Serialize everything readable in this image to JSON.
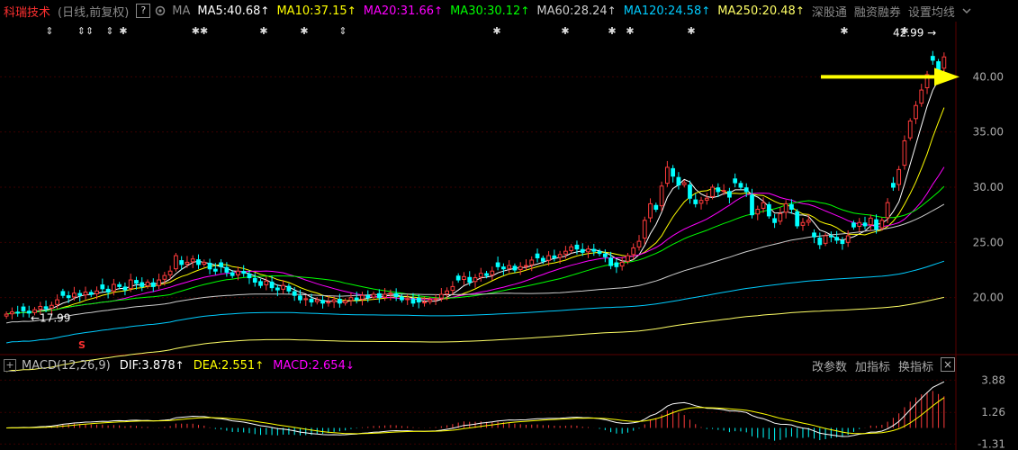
{
  "toolbar": {
    "title": "科瑞技术",
    "period": "(日线,前复权)",
    "help_label": "?",
    "gear_icon": "gear-icon",
    "ma_label": "MA",
    "ma_items": [
      {
        "label": "MA5:40.68",
        "color": "#ffffff",
        "arrow": "↑"
      },
      {
        "label": "MA10:37.15",
        "color": "#ffff00",
        "arrow": "↑"
      },
      {
        "label": "MA20:31.66",
        "color": "#ff00ff",
        "arrow": "↑"
      },
      {
        "label": "MA30:30.12",
        "color": "#00ff00",
        "arrow": "↑"
      },
      {
        "label": "MA60:28.24",
        "color": "#cccccc",
        "arrow": "↑"
      },
      {
        "label": "MA120:24.58",
        "color": "#00ccff",
        "arrow": "↑"
      },
      {
        "label": "MA250:20.48",
        "color": "#ffff66",
        "arrow": "↑"
      }
    ],
    "links": [
      "深股通",
      "融资融券",
      "设置均线"
    ],
    "chevron_icon": "chevron-down-icon"
  },
  "macd_bar": {
    "plus_label": "+",
    "name": "MACD(12,26,9)",
    "dif": "DIF:3.878",
    "dea": "DEA:2.551",
    "macd": "MACD:2.654",
    "dif_arrow": "↑",
    "dea_arrow": "↑",
    "macd_arrow": "↓",
    "buttons": [
      "改参数",
      "加指标",
      "换指标"
    ],
    "close_label": "×"
  },
  "colors": {
    "up": "#ff3b3b",
    "down": "#00ffff",
    "grid": "#3a0000",
    "axis": "#aaaaaa",
    "annotation_arrow": "#ffff00",
    "dif": "#ffffff",
    "dea": "#ffff00",
    "macd": "#ff00ff"
  },
  "chart_data": [
    {
      "type": "candlestick",
      "y_ticks": [
        "40.00",
        "35.00",
        "30.00",
        "25.00",
        "20.00"
      ],
      "ylim": [
        15.0,
        45.0
      ],
      "grid": true,
      "max_label": "42.99",
      "min_label": "17.99",
      "max_marker": "→",
      "min_marker": "←",
      "event_marks": [
        "⇕",
        "⇕⇕",
        "⇕",
        "✱",
        "✱✱",
        "✱",
        "✱",
        "⇕",
        "✱",
        "✱",
        "✱",
        "✱",
        "✱",
        "✱",
        "✱"
      ],
      "bottom_mark": "S",
      "close": [
        18.5,
        18.7,
        18.6,
        18.8,
        18.6,
        18.9,
        19.2,
        19.0,
        19.3,
        19.8,
        20.2,
        20.0,
        20.4,
        20.2,
        20.5,
        20.3,
        20.6,
        20.8,
        20.5,
        21.2,
        21.0,
        20.7,
        21.6,
        21.3,
        21.0,
        21.4,
        21.0,
        21.6,
        22.0,
        22.4,
        23.8,
        23.0,
        23.2,
        23.5,
        23.0,
        23.2,
        22.6,
        22.4,
        22.8,
        22.3,
        22.0,
        22.4,
        22.2,
        21.8,
        21.4,
        21.1,
        21.5,
        20.9,
        20.7,
        21.1,
        20.6,
        20.2,
        19.8,
        19.9,
        19.6,
        19.8,
        19.5,
        19.6,
        19.8,
        19.5,
        19.7,
        20.0,
        19.8,
        20.2,
        20.0,
        20.3,
        20.0,
        20.3,
        20.4,
        20.1,
        19.8,
        19.9,
        19.5,
        19.6,
        19.6,
        19.8,
        19.9,
        20.3,
        20.6,
        21.0,
        21.6,
        21.9,
        21.4,
        21.8,
        22.2,
        22.0,
        22.4,
        22.8,
        22.6,
        22.9,
        22.5,
        22.8,
        22.9,
        23.4,
        23.6,
        23.3,
        23.8,
        23.6,
        23.9,
        24.2,
        24.6,
        24.4,
        24.1,
        24.4,
        24.2,
        24.0,
        23.7,
        22.9,
        22.8,
        23.2,
        23.8,
        24.5,
        25.1,
        27.0,
        28.5,
        28.0,
        30.1,
        31.8,
        31.0,
        30.2,
        30.4,
        29.0,
        28.5,
        28.8,
        29.0,
        30.0,
        29.6,
        29.7,
        29.1,
        30.4,
        30.0,
        29.6,
        27.5,
        28.0,
        28.6,
        27.4,
        26.8,
        27.6,
        28.5,
        28.0,
        26.5,
        26.8,
        27.0,
        25.5,
        24.8,
        25.6,
        25.5,
        25.2,
        24.9,
        25.6,
        26.4,
        26.8,
        26.5,
        27.2,
        26.2,
        27.0,
        28.6,
        30.0,
        31.6,
        34.2,
        36.0,
        37.4,
        38.8,
        40.2,
        41.5,
        40.6,
        41.8
      ],
      "ma_series": [
        {
          "name": "MA5",
          "color": "#ffffff"
        },
        {
          "name": "MA10",
          "color": "#ffff00"
        },
        {
          "name": "MA20",
          "color": "#ff00ff"
        },
        {
          "name": "MA30",
          "color": "#00ff00"
        },
        {
          "name": "MA60",
          "color": "#cccccc"
        },
        {
          "name": "MA120",
          "color": "#00ccff"
        },
        {
          "name": "MA250",
          "color": "#ffff66"
        }
      ]
    },
    {
      "type": "macd",
      "y_ticks": [
        "3.88",
        "1.26",
        "-1.31"
      ],
      "ylim": [
        -1.5,
        4.2
      ]
    }
  ]
}
